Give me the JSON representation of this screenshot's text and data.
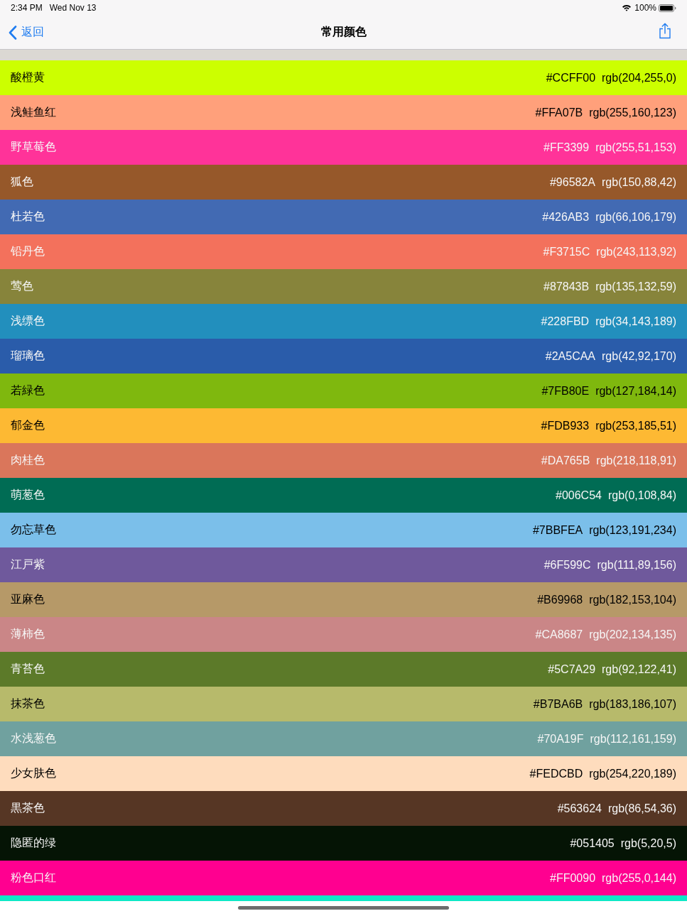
{
  "status_bar": {
    "time": "2:34 PM",
    "date": "Wed Nov 13",
    "battery": "100%"
  },
  "nav_bar": {
    "back": "返回",
    "title": "常用颜色"
  },
  "colors": [
    {
      "name": "酸橙黄",
      "hex": "#CCFF00",
      "rgb": "rgb(204,255,0)",
      "color": "#ccff00",
      "light_text": false
    },
    {
      "name": "浅鲑鱼红",
      "hex": "#FFA07B",
      "rgb": "rgb(255,160,123)",
      "color": "#ffa07b",
      "light_text": false
    },
    {
      "name": "野草莓色",
      "hex": "#FF3399",
      "rgb": "rgb(255,51,153)",
      "color": "#ff3399",
      "light_text": true
    },
    {
      "name": "狐色",
      "hex": "#96582A",
      "rgb": "rgb(150,88,42)",
      "color": "#96582a",
      "light_text": true
    },
    {
      "name": "杜若色",
      "hex": "#426AB3",
      "rgb": "rgb(66,106,179)",
      "color": "#426ab3",
      "light_text": true
    },
    {
      "name": "铅丹色",
      "hex": "#F3715C",
      "rgb": "rgb(243,113,92)",
      "color": "#f3715c",
      "light_text": true
    },
    {
      "name": "莺色",
      "hex": "#87843B",
      "rgb": "rgb(135,132,59)",
      "color": "#87843b",
      "light_text": true
    },
    {
      "name": "浅缥色",
      "hex": "#228FBD",
      "rgb": "rgb(34,143,189)",
      "color": "#228fbd",
      "light_text": true
    },
    {
      "name": "瑠璃色",
      "hex": "#2A5CAA",
      "rgb": "rgb(42,92,170)",
      "color": "#2a5caa",
      "light_text": true
    },
    {
      "name": "若緑色",
      "hex": "#7FB80E",
      "rgb": "rgb(127,184,14)",
      "color": "#7fb80e",
      "light_text": false
    },
    {
      "name": "郁金色",
      "hex": "#FDB933",
      "rgb": "rgb(253,185,51)",
      "color": "#fdb933",
      "light_text": false
    },
    {
      "name": "肉桂色",
      "hex": "#DA765B",
      "rgb": "rgb(218,118,91)",
      "color": "#da765b",
      "light_text": true
    },
    {
      "name": "萌葱色",
      "hex": "#006C54",
      "rgb": "rgb(0,108,84)",
      "color": "#006c54",
      "light_text": true
    },
    {
      "name": "勿忘草色",
      "hex": "#7BBFEA",
      "rgb": "rgb(123,191,234)",
      "color": "#7bbfea",
      "light_text": false
    },
    {
      "name": "江戸紫",
      "hex": "#6F599C",
      "rgb": "rgb(111,89,156)",
      "color": "#6f599c",
      "light_text": true
    },
    {
      "name": "亚麻色",
      "hex": "#B69968",
      "rgb": "rgb(182,153,104)",
      "color": "#b69968",
      "light_text": false
    },
    {
      "name": "薄柿色",
      "hex": "#CA8687",
      "rgb": "rgb(202,134,135)",
      "color": "#ca8687",
      "light_text": true
    },
    {
      "name": "青苔色",
      "hex": "#5C7A29",
      "rgb": "rgb(92,122,41)",
      "color": "#5c7a29",
      "light_text": true
    },
    {
      "name": "抹茶色",
      "hex": "#B7BA6B",
      "rgb": "rgb(183,186,107)",
      "color": "#b7ba6b",
      "light_text": false
    },
    {
      "name": "水浅葱色",
      "hex": "#70A19F",
      "rgb": "rgb(112,161,159)",
      "color": "#70a19f",
      "light_text": true
    },
    {
      "name": "少女肤色",
      "hex": "#FEDCBD",
      "rgb": "rgb(254,220,189)",
      "color": "#fedcbd",
      "light_text": false
    },
    {
      "name": "黒茶色",
      "hex": "#563624",
      "rgb": "rgb(86,54,36)",
      "color": "#563624",
      "light_text": true
    },
    {
      "name": "隐匿的绿",
      "hex": "#051405",
      "rgb": "rgb(5,20,5)",
      "color": "#051405",
      "light_text": true
    },
    {
      "name": "粉色口红",
      "hex": "#FF0090",
      "rgb": "rgb(255,0,144)",
      "color": "#ff0090",
      "light_text": true
    }
  ],
  "next_row": {
    "color": "#0ee8c6"
  }
}
